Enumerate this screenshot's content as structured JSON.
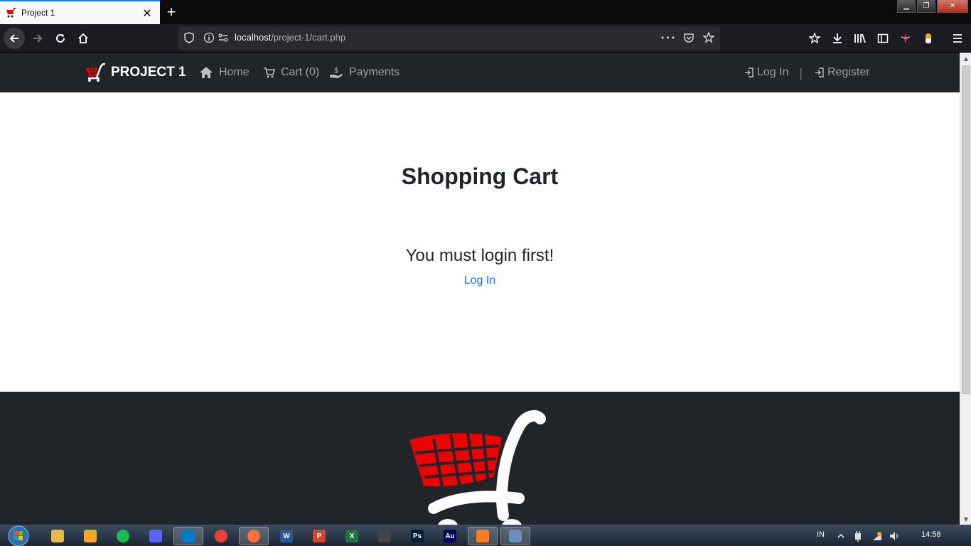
{
  "browser": {
    "tab_title": "Project 1",
    "tab_close": "✕",
    "new_tab": "+",
    "url_host": "localhost",
    "url_path": "/project-1/cart.php",
    "menu_dots": "•••"
  },
  "window": {
    "minimize": "▁",
    "restore": "❐",
    "close": "✕"
  },
  "site": {
    "brand": "PROJECT 1",
    "nav": {
      "home": "Home",
      "cart": "Cart (0)",
      "payments": "Payments"
    },
    "auth": {
      "login": "Log In",
      "separator": "|",
      "register": "Register"
    }
  },
  "main": {
    "title": "Shopping Cart",
    "message": "You must login first!",
    "login_link": "Log In"
  },
  "taskbar": {
    "apps": [
      {
        "name": "explorer",
        "letter": "",
        "color": "#e8b84a"
      },
      {
        "name": "media-player",
        "letter": "",
        "color": "#f5a623"
      },
      {
        "name": "spotify",
        "letter": "",
        "color": "#1db954"
      },
      {
        "name": "discord",
        "letter": "",
        "color": "#5865f2"
      },
      {
        "name": "vscode",
        "letter": "",
        "color": "#007acc"
      },
      {
        "name": "chrome",
        "letter": "",
        "color": "#ea4335"
      },
      {
        "name": "firefox",
        "letter": "",
        "color": "#ff7139"
      },
      {
        "name": "word",
        "letter": "W",
        "color": "#2b579a"
      },
      {
        "name": "powerpoint",
        "letter": "P",
        "color": "#d24726"
      },
      {
        "name": "excel",
        "letter": "X",
        "color": "#217346"
      },
      {
        "name": "inkscape",
        "letter": "",
        "color": "#444"
      },
      {
        "name": "photoshop",
        "letter": "Ps",
        "color": "#001e36"
      },
      {
        "name": "audition",
        "letter": "Au",
        "color": "#00005b"
      },
      {
        "name": "xampp",
        "letter": "",
        "color": "#fb7a24"
      },
      {
        "name": "paint",
        "letter": "",
        "color": "#6a8fbf"
      }
    ],
    "lang": "IN",
    "clock": "14:58"
  }
}
